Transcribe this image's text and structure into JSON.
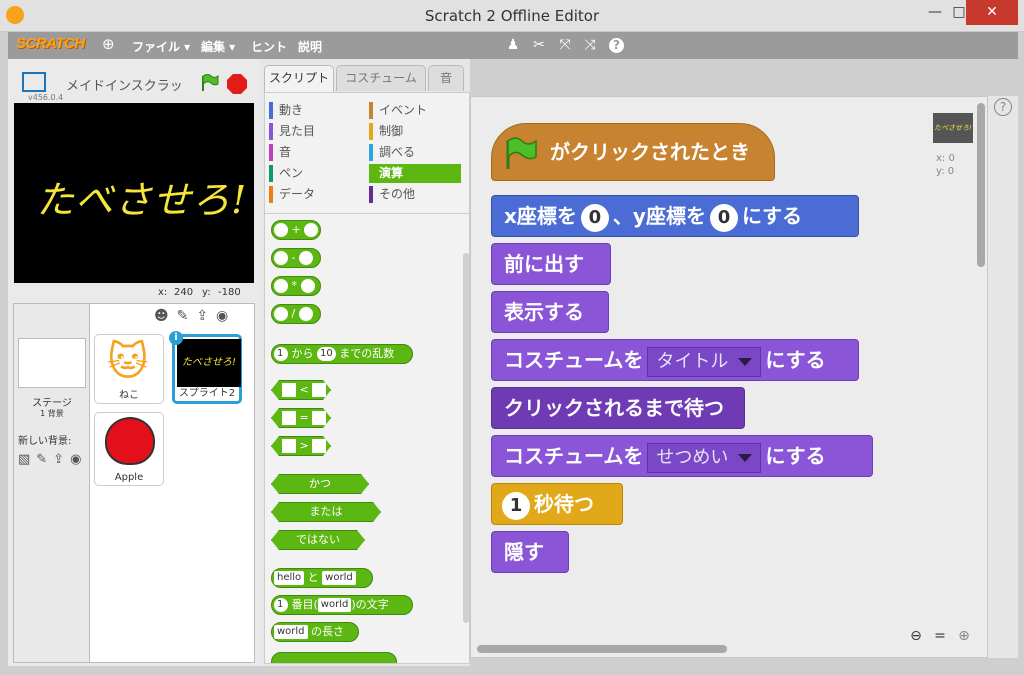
{
  "window": {
    "title": "Scratch 2 Offline Editor",
    "minimize": "—",
    "maximize": "□",
    "close": "✕"
  },
  "menubar": {
    "logo": "SCRATCH",
    "file": "ファイル ▾",
    "edit": "編集 ▾",
    "tips": "ヒント",
    "about": "説明"
  },
  "stage": {
    "project_name": "メイドインスクラッ",
    "version": "v456.0.4",
    "stage_text": "たべさせろ!",
    "x_label": "x:",
    "x_value": "240",
    "y_label": "y:",
    "y_value": "-180"
  },
  "sprite_pane": {
    "stage_label": "ステージ",
    "stage_bg_count": "1 背景",
    "new_backdrop": "新しい背景:",
    "sprites": [
      {
        "name": "ねこ"
      },
      {
        "name": "スプライト2"
      },
      {
        "name": "Apple"
      }
    ],
    "info_badge": "i"
  },
  "tabs": [
    {
      "label": "スクリプト"
    },
    {
      "label": "コスチューム"
    },
    {
      "label": "音"
    }
  ],
  "categories": [
    {
      "label": "動き",
      "color": "#4a6cd4"
    },
    {
      "label": "イベント",
      "color": "#c88330"
    },
    {
      "label": "見た目",
      "color": "#8a55d7"
    },
    {
      "label": "制御",
      "color": "#e1a91a"
    },
    {
      "label": "音",
      "color": "#bb42c3"
    },
    {
      "label": "調べる",
      "color": "#2ca5e2"
    },
    {
      "label": "ペン",
      "color": "#0e9a6c"
    },
    {
      "label": "演算",
      "color": "#5cb712"
    },
    {
      "label": "データ",
      "color": "#ee7d16"
    },
    {
      "label": "その他",
      "color": "#632d99"
    }
  ],
  "palette": {
    "ops": [
      "+",
      "-",
      "*",
      "/"
    ],
    "random": {
      "val1": "1",
      "mid": "から",
      "val2": "10",
      "end": "までの乱数"
    },
    "compare": [
      "<",
      "=",
      ">"
    ],
    "logic": [
      "かつ",
      "または",
      "ではない"
    ],
    "join": {
      "a": "hello",
      "mid": "と",
      "b": "world"
    },
    "letter": {
      "a": "1",
      "mid": "番目(",
      "b": "world",
      "end": ")の文字"
    },
    "length": {
      "a": "world",
      "end": "の長さ"
    }
  },
  "script": {
    "hat": "がクリックされたとき",
    "goto": {
      "a": "x座標を",
      "x": "0",
      "b": "、y座標を",
      "y": "0",
      "c": "にする"
    },
    "front": "前に出す",
    "show": "表示する",
    "costume1": {
      "a": "コスチュームを",
      "dd": "タイトル",
      "b": "にする"
    },
    "waitclick": "クリックされるまで待つ",
    "costume2": {
      "a": "コスチュームを",
      "dd": "せつめい",
      "b": "にする"
    },
    "wait": {
      "val": "1",
      "a": "秒待つ"
    },
    "hide": "隠す",
    "thumb_text": "たべさせろ!",
    "x_readout": "x: 0",
    "y_readout": "y: 0"
  },
  "colors": {
    "motion": "#4a6cd4",
    "looks": "#8a55d7",
    "control": "#e1a91a",
    "events": "#c88330",
    "operators": "#5cb712"
  }
}
